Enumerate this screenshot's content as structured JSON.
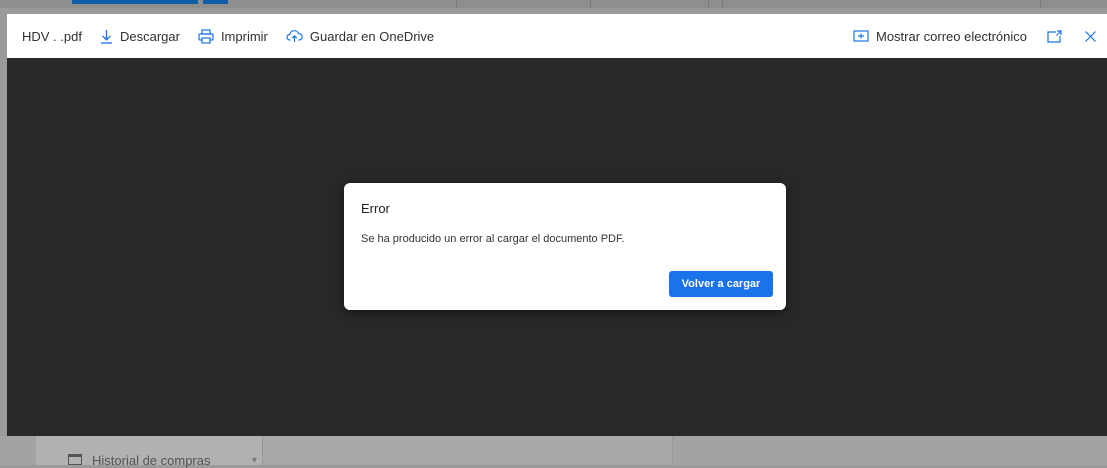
{
  "toolbar": {
    "file_name": "HDV . .pdf",
    "download_label": "Descargar",
    "print_label": "Imprimir",
    "save_onedrive_label": "Guardar en OneDrive",
    "show_email_label": "Mostrar correo electrónico",
    "icons": {
      "download": "download-icon",
      "print": "printer-icon",
      "save": "cloud-upload-icon",
      "show_email": "email-view-icon",
      "popout": "popout-icon",
      "close": "close-icon"
    }
  },
  "dialog": {
    "title": "Error",
    "message": "Se ha producido un error al cargar el documento PDF.",
    "reload_label": "Volver a cargar"
  },
  "background": {
    "folder_label": "Historial de compras"
  },
  "colors": {
    "accent": "#1a73e8",
    "viewer_background": "#282828"
  }
}
